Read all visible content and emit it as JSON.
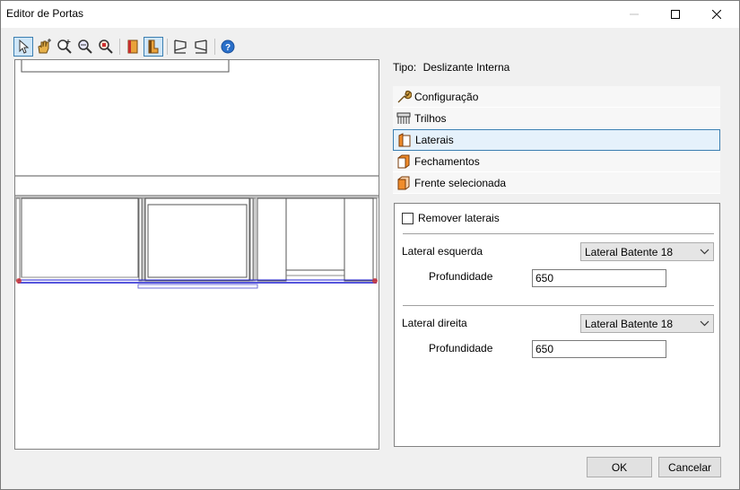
{
  "window": {
    "title": "Editor de Portas"
  },
  "tipo": {
    "label": "Tipo:",
    "value": "Deslizante Interna"
  },
  "sections": [
    {
      "label": "Configuração",
      "icon": "wrench-icon"
    },
    {
      "label": "Trilhos",
      "icon": "rails-icon"
    },
    {
      "label": "Laterais",
      "icon": "laterais-icon",
      "selected": true
    },
    {
      "label": "Fechamentos",
      "icon": "fechamentos-icon"
    },
    {
      "label": "Frente selecionada",
      "icon": "frente-icon"
    }
  ],
  "panel": {
    "remover_label": "Remover laterais",
    "remover_checked": false,
    "lateral_esquerda": {
      "label": "Lateral esquerda",
      "select_value": "Lateral Batente 18",
      "prof_label": "Profundidade",
      "prof_value": "650"
    },
    "lateral_direita": {
      "label": "Lateral direita",
      "select_value": "Lateral Batente 18",
      "prof_label": "Profundidade",
      "prof_value": "650"
    }
  },
  "buttons": {
    "ok": "OK",
    "cancel": "Cancelar"
  },
  "toolbar": [
    {
      "icon": "select-pointer-icon"
    },
    {
      "icon": "pan-hand-icon"
    },
    {
      "icon": "zoom-in-icon"
    },
    {
      "icon": "zoom-out-icon"
    },
    {
      "icon": "zoom-extents-icon"
    },
    {
      "icon": "view-front-icon"
    },
    {
      "icon": "view-side-icon",
      "active": true
    },
    {
      "icon": "view-left-icon"
    },
    {
      "icon": "view-right-icon"
    },
    {
      "icon": "help-icon"
    }
  ],
  "colors": {
    "accent": "#3c7fb1",
    "selected_bg": "#e5f1fb",
    "door_blue": "#1f1fd1",
    "marker_red": "#d03030"
  }
}
